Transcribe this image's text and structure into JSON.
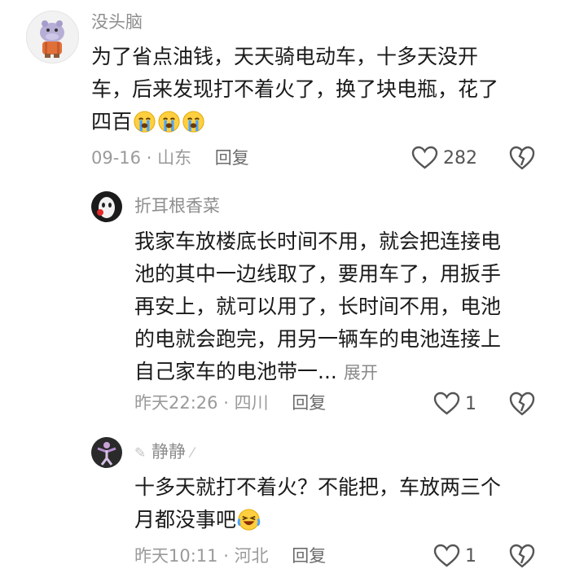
{
  "comments": [
    {
      "user": "没头脑",
      "lines": [
        "为了省点油钱，天天骑电动车，十多天没开",
        "车，后来发现打不着火了，换了块电瓶，花了",
        "四百"
      ],
      "emoji_count": 3,
      "date": "09-16",
      "location": "山东",
      "reply": "回复",
      "likes": "282"
    },
    {
      "user": "折耳根香菜",
      "lines": [
        "我家车放楼底长时间不用，就会把连接电",
        "池的其中一边线取了，要用车了，用扳手",
        "再安上，就可以用了，长时间不用，电池",
        "的电就会跑完，用另一辆车的电池连接上",
        "自己家车的电池带一..."
      ],
      "expand": "展开",
      "date": "昨天22:26",
      "location": "四川",
      "reply": "回复",
      "likes": "1"
    },
    {
      "user": "静静",
      "lines": [
        "十多天就打不着火？不能把，车放两三个",
        "月都没事吧"
      ],
      "emoji_count": 1,
      "date": "昨天10:11",
      "location": "河北",
      "reply": "回复",
      "likes": "1"
    }
  ],
  "colors": {
    "text": "#1a1a1a",
    "meta": "#9a9a9a",
    "emoji": "#4da3ff",
    "emoji_face": "#ffcf3f"
  }
}
